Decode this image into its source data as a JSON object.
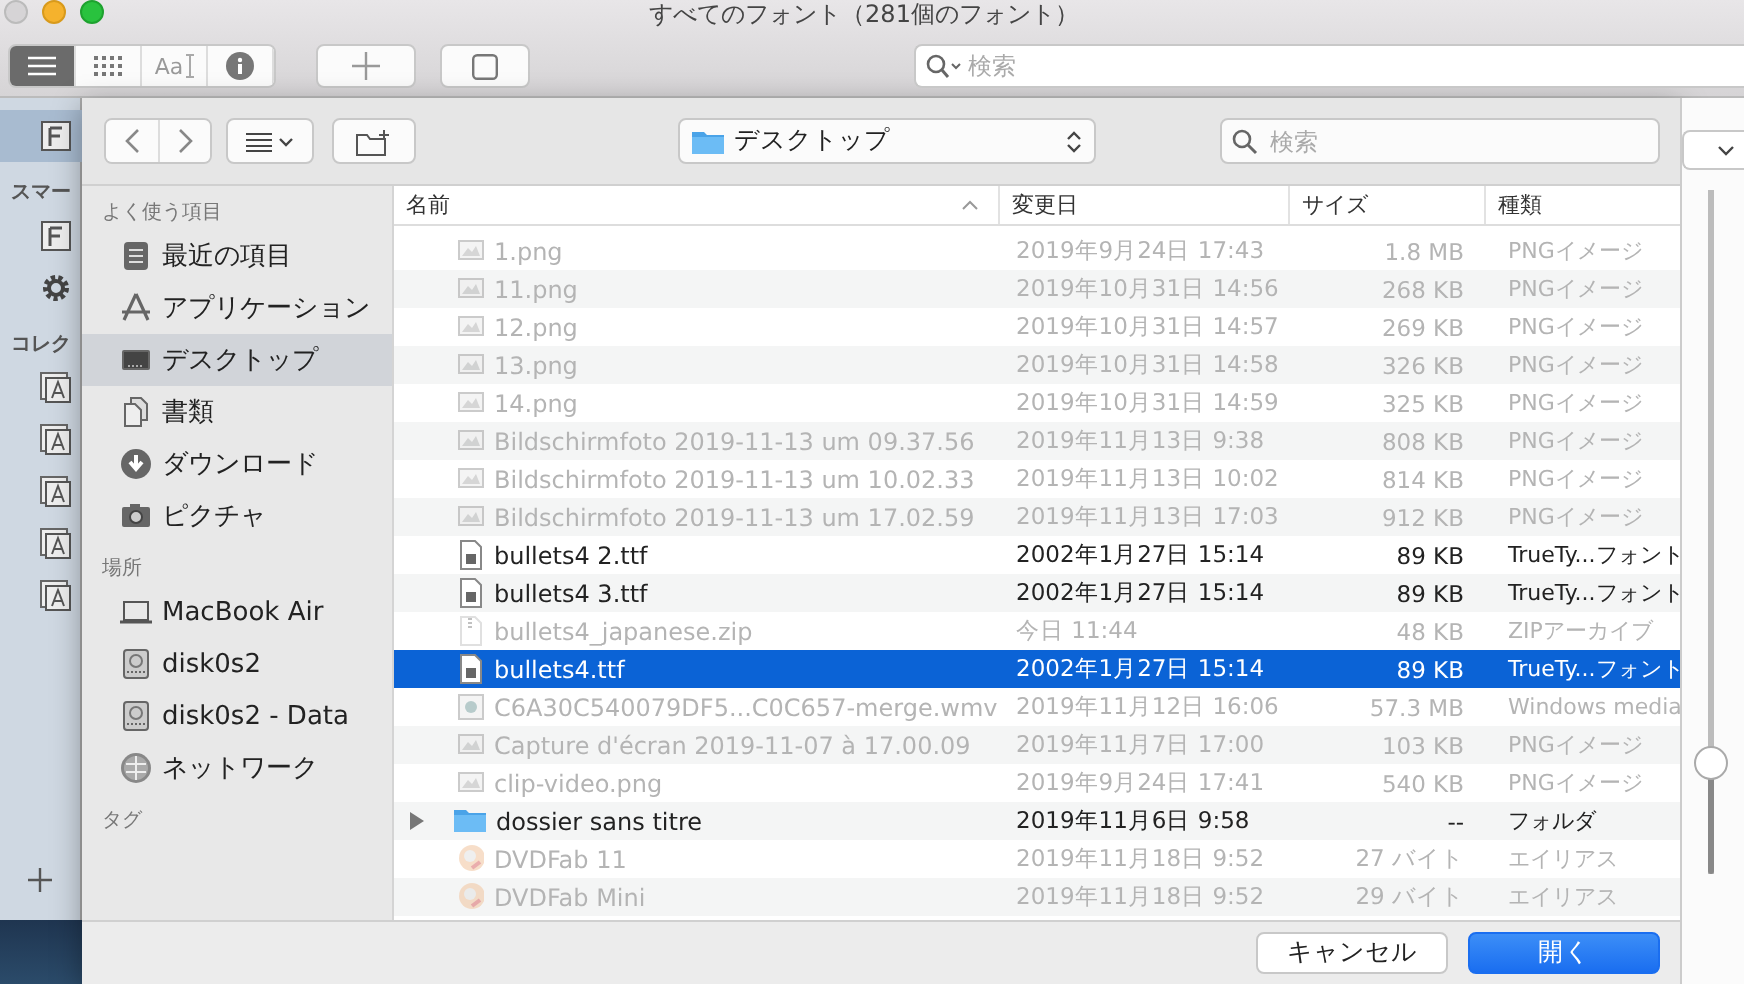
{
  "window": {
    "title": "すべてのフォント（281個のフォント）"
  },
  "toolbar": {
    "view_segments": [
      {
        "kind": "list",
        "selected": true
      },
      {
        "kind": "grid",
        "selected": false
      },
      {
        "kind": "sample",
        "label": "Aa",
        "selected": false
      },
      {
        "kind": "info",
        "selected": false
      }
    ],
    "search": {
      "placeholder": "検索"
    }
  },
  "background_sidebar": {
    "sections": [
      {
        "items": [
          {
            "kind": "font",
            "selected": true
          }
        ]
      },
      {
        "title": "スマー",
        "items": [
          {
            "kind": "font",
            "selected": false
          },
          {
            "kind": "gear",
            "selected": false
          }
        ]
      },
      {
        "title": "コレク",
        "items": [
          {
            "kind": "collection",
            "selected": false
          },
          {
            "kind": "collection",
            "selected": false
          },
          {
            "kind": "collection",
            "selected": false
          },
          {
            "kind": "collection",
            "selected": false
          },
          {
            "kind": "collection",
            "selected": false
          }
        ]
      }
    ]
  },
  "dialog": {
    "toolbar": {
      "location": "デスクトップ",
      "search": {
        "placeholder": "検索"
      }
    },
    "sidebar": {
      "sections": [
        {
          "title": "よく使う項目",
          "items": [
            {
              "label": "最近の項目",
              "kind": "recents",
              "selected": false
            },
            {
              "label": "アプリケーション",
              "kind": "applications",
              "selected": false
            },
            {
              "label": "デスクトップ",
              "kind": "desktop",
              "selected": true
            },
            {
              "label": "書類",
              "kind": "documents",
              "selected": false
            },
            {
              "label": "ダウンロード",
              "kind": "downloads",
              "selected": false
            },
            {
              "label": "ピクチャ",
              "kind": "pictures",
              "selected": false
            }
          ]
        },
        {
          "title": "場所",
          "items": [
            {
              "label": "MacBook Air",
              "kind": "laptop",
              "selected": false
            },
            {
              "label": "disk0s2",
              "kind": "disk",
              "selected": false
            },
            {
              "label": "disk0s2 - Data",
              "kind": "disk",
              "selected": false
            },
            {
              "label": "ネットワーク",
              "kind": "network",
              "selected": false
            }
          ]
        },
        {
          "title": "タグ"
        }
      ]
    },
    "table": {
      "columns": [
        {
          "label": "名前",
          "sorted": true
        },
        {
          "label": "変更日",
          "sorted": false
        },
        {
          "label": "サイズ",
          "sorted": false
        },
        {
          "label": "種類",
          "sorted": false
        }
      ],
      "rows": [
        {
          "name": "1.png",
          "kind": "image",
          "date": "2019年9月24日 17:43",
          "size": "1.8 MB",
          "type": "PNGイメージ",
          "disabled": true,
          "selected": false
        },
        {
          "name": "11.png",
          "kind": "image",
          "date": "2019年10月31日 14:56",
          "size": "268 KB",
          "type": "PNGイメージ",
          "disabled": true,
          "selected": false
        },
        {
          "name": "12.png",
          "kind": "image",
          "date": "2019年10月31日 14:57",
          "size": "269 KB",
          "type": "PNGイメージ",
          "disabled": true,
          "selected": false
        },
        {
          "name": "13.png",
          "kind": "image",
          "date": "2019年10月31日 14:58",
          "size": "326 KB",
          "type": "PNGイメージ",
          "disabled": true,
          "selected": false
        },
        {
          "name": "14.png",
          "kind": "image",
          "date": "2019年10月31日 14:59",
          "size": "325 KB",
          "type": "PNGイメージ",
          "disabled": true,
          "selected": false
        },
        {
          "name": "Bildschirmfoto 2019-11-13 um 09.37.56",
          "kind": "image",
          "date": "2019年11月13日 9:38",
          "size": "808 KB",
          "type": "PNGイメージ",
          "disabled": true,
          "selected": false
        },
        {
          "name": "Bildschirmfoto 2019-11-13 um 10.02.33",
          "kind": "image",
          "date": "2019年11月13日 10:02",
          "size": "814 KB",
          "type": "PNGイメージ",
          "disabled": true,
          "selected": false
        },
        {
          "name": "Bildschirmfoto 2019-11-13 um 17.02.59",
          "kind": "image",
          "date": "2019年11月13日 17:03",
          "size": "912 KB",
          "type": "PNGイメージ",
          "disabled": true,
          "selected": false
        },
        {
          "name": "bullets4 2.ttf",
          "kind": "font",
          "date": "2002年1月27日 15:14",
          "size": "89 KB",
          "type": "TrueTy...フォント",
          "disabled": false,
          "selected": false
        },
        {
          "name": "bullets4 3.ttf",
          "kind": "font",
          "date": "2002年1月27日 15:14",
          "size": "89 KB",
          "type": "TrueTy...フォント",
          "disabled": false,
          "selected": false
        },
        {
          "name": "bullets4_japanese.zip",
          "kind": "zip",
          "date": "今日 11:44",
          "size": "48 KB",
          "type": "ZIPアーカイブ",
          "disabled": true,
          "selected": false
        },
        {
          "name": "bullets4.ttf",
          "kind": "font",
          "date": "2002年1月27日 15:14",
          "size": "89 KB",
          "type": "TrueTy...フォント",
          "disabled": false,
          "selected": true
        },
        {
          "name": "C6A30C540079DF5...C0C657-merge.wmv",
          "kind": "video",
          "date": "2019年11月12日 16:06",
          "size": "57.3 MB",
          "type": "Windows media",
          "disabled": true,
          "selected": false
        },
        {
          "name": "Capture d'écran 2019-11-07 à 17.00.09",
          "kind": "image",
          "date": "2019年11月7日 17:00",
          "size": "103 KB",
          "type": "PNGイメージ",
          "disabled": true,
          "selected": false
        },
        {
          "name": "clip-video.png",
          "kind": "image",
          "date": "2019年9月24日 17:41",
          "size": "540 KB",
          "type": "PNGイメージ",
          "disabled": true,
          "selected": false
        },
        {
          "name": "dossier sans titre",
          "kind": "folder",
          "date": "2019年11月6日 9:58",
          "size": "--",
          "type": "フォルダ",
          "disabled": false,
          "selected": false
        },
        {
          "name": "DVDFab 11",
          "kind": "alias",
          "date": "2019年11月18日 9:52",
          "size": "27 バイト",
          "type": "エイリアス",
          "disabled": true,
          "selected": false
        },
        {
          "name": "DVDFab Mini",
          "kind": "alias",
          "date": "2019年11月18日 9:52",
          "size": "29 バイト",
          "type": "エイリアス",
          "disabled": true,
          "selected": false
        }
      ]
    },
    "buttons": [
      {
        "label": "キャンセル",
        "default": false
      },
      {
        "label": "開く",
        "default": true
      }
    ]
  },
  "size_slider": {
    "level": 0.16
  }
}
